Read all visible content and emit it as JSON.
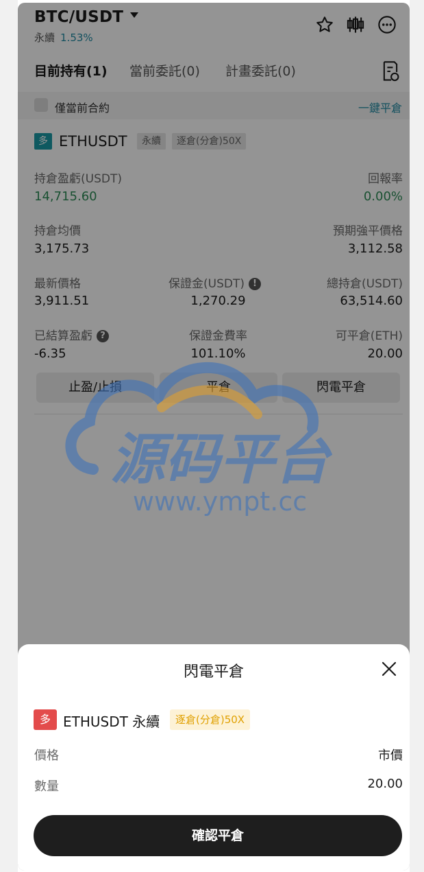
{
  "header": {
    "pair": "BTC/USDT",
    "contract_type": "永續",
    "change": "1.53%",
    "icons": [
      "star-icon",
      "candlestick-icon",
      "more-icon"
    ]
  },
  "tabs": [
    {
      "label": "目前持有(1)",
      "active": true
    },
    {
      "label": "當前委託(0)",
      "active": false
    },
    {
      "label": "計畫委託(0)",
      "active": false
    }
  ],
  "filter": {
    "checkbox_label": "僅當前合約",
    "close_all": "一鍵平倉"
  },
  "position": {
    "side": "多",
    "symbol": "ETHUSDT",
    "type_tag": "永續",
    "margin_tag": "逐倉(分倉)50X",
    "pnl_label": "持倉盈虧(USDT)",
    "pnl_value": "14,715.60",
    "roe_label": "回報率",
    "roe_value": "0.00%",
    "avg_label": "持倉均價",
    "avg_value": "3,175.73",
    "liq_label": "預期強平價格",
    "liq_value": "3,112.58",
    "last_label": "最新價格",
    "last_value": "3,911.51",
    "margin_label": "保證金(USDT)",
    "margin_value": "1,270.29",
    "total_label": "總持倉(USDT)",
    "total_value": "63,514.60",
    "realized_label": "已結算盈虧",
    "realized_value": "-6.35",
    "margin_rate_label": "保證金費率",
    "margin_rate_value": "101.10%",
    "closable_label": "可平倉(ETH)",
    "closable_value": "20.00",
    "btn_tpsl": "止盈/止損",
    "btn_close": "平倉",
    "btn_flash_close": "閃電平倉"
  },
  "watermark": {
    "title": "源码平台",
    "url": "www.ympt.cc"
  },
  "sheet": {
    "title": "閃電平倉",
    "side": "多",
    "symbol": "ETHUSDT 永續",
    "margin_tag": "逐倉(分倉)50X",
    "price_label": "價格",
    "price_value": "市價",
    "qty_label": "數量",
    "qty_value": "20.00",
    "confirm": "確認平倉"
  },
  "colors": {
    "accent": "#1f8aa3",
    "long_badge": "#1b9aa6",
    "sheet_long_badge": "#e34b4b",
    "profit": "#2e8c57",
    "tag_yellow": "#e0a000"
  }
}
